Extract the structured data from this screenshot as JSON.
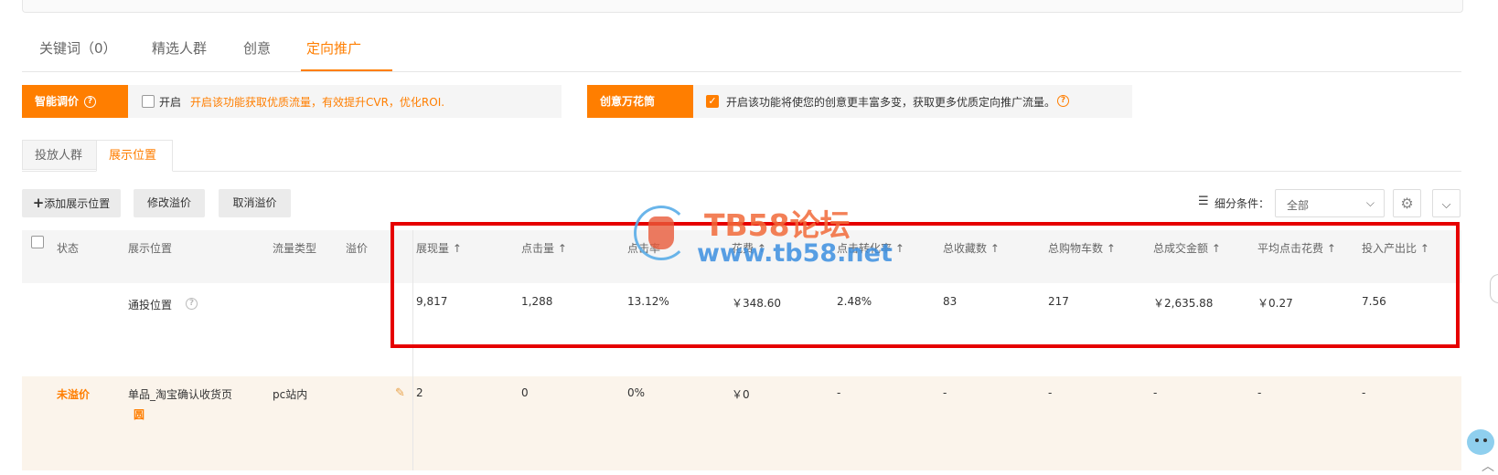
{
  "main_tabs": [
    {
      "label": "关键词（0）",
      "active": false
    },
    {
      "label": "精选人群",
      "active": false
    },
    {
      "label": "创意",
      "active": false
    },
    {
      "label": "定向推广",
      "active": true
    }
  ],
  "smart_bid": {
    "label": "智能调价",
    "toggle_label": "开启",
    "checked": false,
    "description": "开启该功能获取优质流量，有效提升CVR，优化ROI."
  },
  "creative_flower": {
    "label": "创意万花筒",
    "checked": true,
    "description": "开启该功能将使您的创意更丰富多变，获取更多优质定向推广流量。"
  },
  "sub_tabs": [
    {
      "label": "投放人群",
      "active": false
    },
    {
      "label": "展示位置",
      "active": true
    }
  ],
  "toolbar": {
    "add_label": "添加展示位置",
    "modify_label": "修改溢价",
    "cancel_label": "取消溢价",
    "filter_label": "细分条件：",
    "filter_value": "全部"
  },
  "table": {
    "columns": {
      "status": "状态",
      "position": "展示位置",
      "traffic_type": "流量类型",
      "premium": "溢价",
      "impressions": "展现量 ↑",
      "clicks": "点击量 ↑",
      "ctr": "点击率",
      "cost": "花费 ↑",
      "cvr": "点击转化率 ↑",
      "favorites": "总收藏数 ↑",
      "carts": "总购物车数 ↑",
      "gmv": "总成交金额 ↑",
      "cpc": "平均点击花费 ↑",
      "roi": "投入产出比 ↑"
    },
    "summary_row": {
      "position": "通投位置",
      "impressions": "9,817",
      "clicks": "1,288",
      "ctr": "13.12%",
      "cost": "￥348.60",
      "cvr": "2.48%",
      "favorites": "83",
      "carts": "217",
      "gmv": "￥2,635.88",
      "cpc": "￥0.27",
      "roi": "7.56"
    },
    "row": {
      "status": "未溢价",
      "position": "单品_淘宝确认收货页",
      "position_badge": "圆",
      "traffic_type": "pc站内",
      "impressions": "2",
      "clicks": "0",
      "ctr": "0%",
      "cost": "￥0",
      "cvr": "-",
      "favorites": "-",
      "carts": "-",
      "gmv": "-",
      "cpc": "-",
      "roi": "-"
    }
  },
  "watermark": {
    "title": "TB58论坛",
    "url": "www.tb58.net"
  },
  "colors": {
    "accent": "#ff7e00",
    "highlight_border": "#e60000",
    "row_highlight_bg": "#fbf4eb"
  }
}
